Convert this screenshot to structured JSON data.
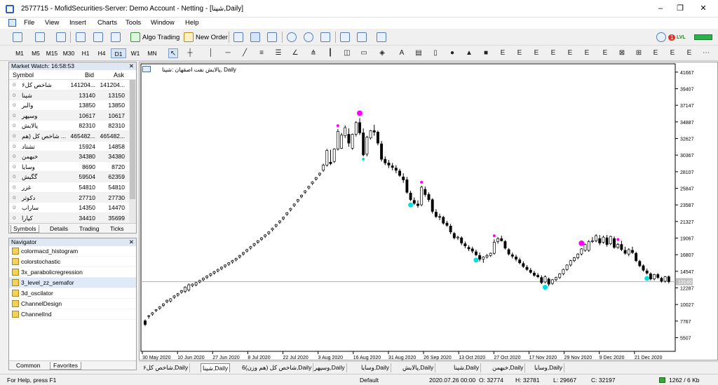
{
  "window": {
    "title": "2577715 - MofidSecurities-Server: Demo Account - Netting - [شپنا,Daily]",
    "min": "–",
    "max": "❐",
    "close": "✕"
  },
  "menu": [
    "File",
    "View",
    "Insert",
    "Charts",
    "Tools",
    "Window",
    "Help"
  ],
  "toolbar": {
    "algo_trading": "Algo Trading",
    "new_order": "New Order",
    "notify_count": "1",
    "signal_label": "LVL"
  },
  "timeframes": [
    "M1",
    "M5",
    "M15",
    "M30",
    "H1",
    "H4",
    "D1",
    "W1",
    "MN"
  ],
  "active_timeframe": "D1",
  "market_watch": {
    "title": "Market Watch: 16:58:53",
    "columns": {
      "symbol": "Symbol",
      "bid": "Bid",
      "ask": "Ask"
    },
    "rows": [
      {
        "symbol": "شاخص كل۶",
        "bid": "141204...",
        "ask": "141204..."
      },
      {
        "symbol": "شپنا",
        "bid": "13140",
        "ask": "13150"
      },
      {
        "symbol": "والبر",
        "bid": "13850",
        "ask": "13850"
      },
      {
        "symbol": "وسپهر",
        "bid": "10617",
        "ask": "10617"
      },
      {
        "symbol": "پالایش",
        "bid": "82310",
        "ask": "82310"
      },
      {
        "symbol": "شاخص كل (هم ...",
        "bid": "465482...",
        "ask": "465482..."
      },
      {
        "symbol": "تشتاد",
        "bid": "15924",
        "ask": "14858"
      },
      {
        "symbol": "خبهمن",
        "bid": "34380",
        "ask": "34380"
      },
      {
        "symbol": "وسایا",
        "bid": "8690",
        "ask": "8720"
      },
      {
        "symbol": "گگیش",
        "bid": "59504",
        "ask": "62359"
      },
      {
        "symbol": "غزر",
        "bid": "54810",
        "ask": "54810"
      },
      {
        "symbol": "دکوثر",
        "bid": "27710",
        "ask": "27730"
      },
      {
        "symbol": "ساراب",
        "bid": "14350",
        "ask": "14470"
      },
      {
        "symbol": "کپارا",
        "bid": "34410",
        "ask": "35699"
      }
    ],
    "tabs": [
      "Symbols",
      "Details",
      "Trading",
      "Ticks"
    ]
  },
  "navigator": {
    "title": "Navigator",
    "items": [
      "colormacd_histogram",
      "colorstochastic",
      "3x_parabolicregression",
      "3_level_zz_semafor",
      "3d_oscilator",
      "ChannelDesign",
      "ChannelInd"
    ],
    "selected_index": 3,
    "tabs": [
      "Common",
      "Favorites"
    ]
  },
  "chart": {
    "symbol_label": "پالایش نفت اصفهان :شپنا, Daily",
    "price_labels": [
      "41667",
      "39407",
      "37147",
      "34887",
      "32627",
      "30367",
      "28107",
      "25847",
      "23587",
      "21327",
      "19067",
      "16807",
      "14547",
      "12287",
      "10027",
      "7767",
      "5507"
    ],
    "current_price": "13140",
    "date_labels": [
      "30 May 2020",
      "10 Jun 2020",
      "27 Jun 2020",
      "8 Jul 2020",
      "22 Jul 2020",
      "3 Aug 2020",
      "16 Aug 2020",
      "31 Aug 2020",
      "26 Sep 2020",
      "13 Oct 2020",
      "27 Oct 2020",
      "17 Nov 2020",
      "29 Nov 2020",
      "9 Dec 2020",
      "21 Dec 2020"
    ]
  },
  "chart_data": {
    "type": "candlestick",
    "price_range": [
      3647,
      42797
    ],
    "candles": [
      [
        7800,
        8000,
        7100,
        7300
      ],
      [
        8400,
        8600,
        8100,
        8500
      ],
      [
        8700,
        9000,
        8500,
        8900
      ],
      [
        9200,
        9400,
        9000,
        9300
      ],
      [
        9500,
        9800,
        9300,
        9700
      ],
      [
        9900,
        10200,
        9700,
        10100
      ],
      [
        10400,
        10700,
        10200,
        10600
      ],
      [
        10500,
        10900,
        10300,
        10800
      ],
      [
        11000,
        11300,
        10800,
        11200
      ],
      [
        11300,
        11600,
        11100,
        11500
      ],
      [
        11700,
        12000,
        11500,
        11900
      ],
      [
        11800,
        12500,
        11600,
        12400
      ],
      [
        12000,
        12900,
        11800,
        12700
      ],
      [
        12600,
        12900,
        12400,
        12800
      ],
      [
        12700,
        13100,
        12500,
        13000
      ],
      [
        13100,
        13400,
        12900,
        13300
      ],
      [
        13400,
        13700,
        13200,
        13600
      ],
      [
        13700,
        14000,
        13500,
        13900
      ],
      [
        14000,
        14300,
        13800,
        14200
      ],
      [
        14300,
        14600,
        14100,
        14500
      ],
      [
        14600,
        14900,
        14400,
        14800
      ],
      [
        14900,
        15200,
        14700,
        15100
      ],
      [
        15200,
        15500,
        15000,
        15400
      ],
      [
        15500,
        15800,
        15300,
        15700
      ],
      [
        15800,
        16100,
        15600,
        16000
      ],
      [
        16100,
        16400,
        15900,
        16300
      ],
      [
        16500,
        16800,
        16300,
        16700
      ],
      [
        16900,
        17200,
        16700,
        17100
      ],
      [
        17300,
        17600,
        17100,
        17500
      ],
      [
        17700,
        18000,
        17500,
        17900
      ],
      [
        18100,
        18400,
        17900,
        18300
      ],
      [
        18500,
        18800,
        18300,
        18700
      ],
      [
        18900,
        19200,
        18700,
        19100
      ],
      [
        19300,
        19600,
        19100,
        19500
      ],
      [
        19700,
        20000,
        19500,
        19900
      ],
      [
        20200,
        20500,
        20000,
        20400
      ],
      [
        20700,
        21000,
        20500,
        20900
      ],
      [
        21200,
        21500,
        21000,
        21400
      ],
      [
        21700,
        22000,
        21500,
        21900
      ],
      [
        22300,
        22600,
        22100,
        22500
      ],
      [
        22900,
        23200,
        22700,
        23100
      ],
      [
        23500,
        23800,
        23300,
        23700
      ],
      [
        24100,
        24400,
        23900,
        24300
      ],
      [
        24700,
        25000,
        24500,
        24900
      ],
      [
        25300,
        25600,
        25100,
        25500
      ],
      [
        25900,
        26200,
        25700,
        26100
      ],
      [
        26500,
        26800,
        26300,
        26700
      ],
      [
        27100,
        27400,
        26900,
        27300
      ],
      [
        27700,
        28000,
        27500,
        27900
      ],
      [
        28300,
        29200,
        28100,
        29000
      ],
      [
        29000,
        31200,
        28800,
        31000
      ],
      [
        29400,
        31100,
        29000,
        29200
      ],
      [
        29500,
        31300,
        29300,
        31200
      ],
      [
        31200,
        33900,
        31000,
        33600
      ],
      [
        31300,
        33400,
        31200,
        33100
      ],
      [
        33000,
        34400,
        32700,
        34100
      ],
      [
        33200,
        34000,
        31500,
        32000
      ],
      [
        31300,
        33300,
        31100,
        33200
      ],
      [
        33200,
        35000,
        32900,
        34800
      ],
      [
        34800,
        35400,
        33100,
        33400
      ],
      [
        33400,
        34000,
        30200,
        30400
      ],
      [
        30500,
        33000,
        30200,
        32800
      ],
      [
        32700,
        33800,
        32500,
        33700
      ],
      [
        33700,
        34500,
        33000,
        33500
      ],
      [
        33500,
        33700,
        31700,
        32000
      ],
      [
        31900,
        32300,
        29500,
        29800
      ],
      [
        29800,
        30200,
        29000,
        29300
      ],
      [
        29300,
        29700,
        28600,
        29000
      ],
      [
        28900,
        29300,
        28300,
        28700
      ],
      [
        28600,
        29000,
        27900,
        28300
      ],
      [
        28200,
        28500,
        27400,
        27600
      ],
      [
        27400,
        27900,
        26600,
        27000
      ],
      [
        27000,
        27400,
        25100,
        25300
      ],
      [
        25200,
        25500,
        24100,
        24300
      ],
      [
        24200,
        24600,
        23600,
        23800
      ],
      [
        23700,
        24200,
        23200,
        23500
      ],
      [
        23600,
        26200,
        23400,
        26000
      ],
      [
        25700,
        26100,
        24700,
        25000
      ],
      [
        25000,
        25300,
        24000,
        24300
      ],
      [
        24300,
        24500,
        22400,
        22700
      ],
      [
        22600,
        23000,
        21800,
        22000
      ],
      [
        22000,
        22400,
        21500,
        21900
      ],
      [
        21900,
        22100,
        20900,
        21100
      ],
      [
        21100,
        21400,
        20600,
        20800
      ],
      [
        20700,
        21000,
        19600,
        19900
      ],
      [
        19700,
        19900,
        18900,
        19100
      ],
      [
        19100,
        19400,
        18800,
        19200
      ],
      [
        19100,
        19300,
        18100,
        18400
      ],
      [
        18300,
        18600,
        17700,
        18000
      ],
      [
        17800,
        18100,
        17300,
        17600
      ],
      [
        17600,
        17900,
        17000,
        17300
      ],
      [
        17200,
        17500,
        16600,
        16800
      ],
      [
        16700,
        17100,
        15900,
        16200
      ],
      [
        16200,
        16600,
        15700,
        16500
      ],
      [
        16500,
        16900,
        16300,
        16700
      ],
      [
        16700,
        17100,
        16500,
        17000
      ],
      [
        17000,
        18900,
        16800,
        18500
      ],
      [
        18600,
        19200,
        18300,
        19000
      ],
      [
        19000,
        19400,
        18600,
        18700
      ],
      [
        18600,
        18800,
        17500,
        17700
      ],
      [
        17500,
        17700,
        16700,
        16900
      ],
      [
        16800,
        17100,
        16300,
        16600
      ],
      [
        16500,
        16800,
        15900,
        16200
      ],
      [
        16100,
        16400,
        15500,
        15700
      ],
      [
        15600,
        15900,
        15000,
        15200
      ],
      [
        15100,
        15400,
        14600,
        14800
      ],
      [
        14700,
        15000,
        14200,
        14400
      ],
      [
        14300,
        14600,
        13800,
        14000
      ],
      [
        14000,
        14300,
        13600,
        13800
      ],
      [
        13700,
        14000,
        12800,
        13000
      ],
      [
        13100,
        14000,
        12900,
        13800
      ],
      [
        13500,
        13700,
        12500,
        12800
      ],
      [
        12900,
        13500,
        12700,
        13400
      ],
      [
        13400,
        13800,
        13200,
        13700
      ],
      [
        13700,
        14300,
        13500,
        14200
      ],
      [
        14200,
        14900,
        14000,
        14800
      ],
      [
        14800,
        15500,
        14600,
        15400
      ],
      [
        15400,
        16100,
        15200,
        16000
      ],
      [
        16000,
        16500,
        15800,
        16400
      ],
      [
        16400,
        17000,
        16200,
        16900
      ],
      [
        16900,
        17700,
        16700,
        17600
      ],
      [
        17400,
        18300,
        17200,
        18200
      ],
      [
        17400,
        18800,
        17200,
        18600
      ],
      [
        18600,
        19200,
        18400,
        18700
      ],
      [
        18700,
        19600,
        18500,
        19400
      ],
      [
        19000,
        19500,
        18100,
        18400
      ],
      [
        18500,
        19400,
        18300,
        19200
      ],
      [
        19100,
        19500,
        17900,
        18200
      ],
      [
        18300,
        19400,
        18100,
        19300
      ],
      [
        19000,
        19300,
        17600,
        17800
      ],
      [
        17800,
        18400,
        17600,
        18200
      ],
      [
        18200,
        18700,
        17300,
        17500
      ],
      [
        17400,
        17900,
        16800,
        17000
      ],
      [
        16900,
        17700,
        16600,
        17500
      ],
      [
        17400,
        17900,
        16900,
        17100
      ],
      [
        17000,
        17200,
        15800,
        16000
      ],
      [
        15900,
        16100,
        15100,
        15300
      ],
      [
        15300,
        15500,
        14500,
        14700
      ],
      [
        14600,
        14900,
        14100,
        14300
      ],
      [
        14200,
        14400,
        13300,
        13500
      ],
      [
        13500,
        14200,
        13300,
        14100
      ],
      [
        14100,
        14300,
        13500,
        13700
      ],
      [
        13600,
        13800,
        13000,
        13200
      ],
      [
        13200,
        13900,
        13000,
        13800
      ],
      [
        13800,
        14000,
        12900,
        13140
      ]
    ],
    "semafor_highs": [
      {
        "index": 53,
        "level": "small"
      },
      {
        "index": 59,
        "level": "big"
      },
      {
        "index": 76,
        "level": "small"
      },
      {
        "index": 96,
        "level": "small"
      },
      {
        "index": 120,
        "level": "big"
      },
      {
        "index": 130,
        "level": "small"
      }
    ],
    "semafor_lows": [
      {
        "index": 60,
        "level": "small"
      },
      {
        "index": 73,
        "level": "big"
      },
      {
        "index": 91,
        "level": "big"
      },
      {
        "index": 110,
        "level": "big"
      },
      {
        "index": 138,
        "level": "big"
      }
    ]
  },
  "tabs": [
    "شاخص كل۶,Daily",
    "شپنا,Daily",
    "شاخص كل (هم وزن)6,Daily",
    "وسپهر,Daily",
    "وسایا,Daily",
    "پالایش,Daily",
    "شپنا,Daily",
    "خبهمن,Daily",
    "وسایا,Daily"
  ],
  "active_tab": 1,
  "status": {
    "help": "For Help, press F1",
    "profile": "Default",
    "datetime": "2020.07.26 00:00",
    "open": "O: 32774",
    "high": "H: 32781",
    "low": "L: 29667",
    "close": "C: 32197",
    "traffic": "1262 / 6 Kb"
  }
}
